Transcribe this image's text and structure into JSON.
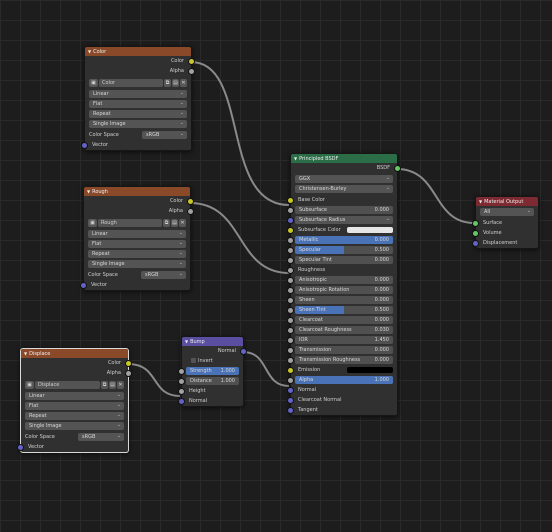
{
  "color_node": {
    "title": "Color",
    "outputs": [
      "Color",
      "Alpha"
    ],
    "image_name": "Color",
    "interpolation": "Linear",
    "projection": "Flat",
    "extension": "Repeat",
    "source": "Single Image",
    "color_space_label": "Color Space",
    "color_space": "sRGB",
    "input": "Vector"
  },
  "rough_node": {
    "title": "Rough",
    "outputs": [
      "Color",
      "Alpha"
    ],
    "image_name": "Rough",
    "interpolation": "Linear",
    "projection": "Flat",
    "extension": "Repeat",
    "source": "Single Image",
    "color_space_label": "Color Space",
    "color_space": "sRGB",
    "input": "Vector"
  },
  "displace_node": {
    "title": "Displace",
    "outputs": [
      "Color",
      "Alpha"
    ],
    "image_name": "Displace",
    "interpolation": "Linear",
    "projection": "Flat",
    "extension": "Repeat",
    "source": "Single Image",
    "color_space_label": "Color Space",
    "color_space": "sRGB",
    "input": "Vector"
  },
  "bump_node": {
    "title": "Bump",
    "output": "Normal",
    "invert_label": "Invert",
    "strength_label": "Strength",
    "strength": "1.000",
    "strength_fraction": 1.0,
    "distance_label": "Distance",
    "distance": "1.000",
    "inputs": [
      "Height",
      "Normal"
    ]
  },
  "bsdf_node": {
    "title": "Principled BSDF",
    "output": "BSDF",
    "distribution": "GGX",
    "subsurface_method": "Christensen-Burley",
    "base_color": "Base Color",
    "subsurface_label": "Subsurface",
    "subsurface": "0.000",
    "subsurface_radius": "Subsurface Radius",
    "subsurface_color": "Subsurface Color",
    "subsurface_color_hex": "#e6e6e6",
    "metallic_label": "Metallic",
    "metallic": "0.000",
    "metallic_fraction": 1.0,
    "specular_label": "Specular",
    "specular": "0.500",
    "specular_fraction": 0.5,
    "specular_tint_label": "Specular Tint",
    "specular_tint": "0.000",
    "roughness": "Roughness",
    "anisotropic_label": "Anisotropic",
    "anisotropic": "0.000",
    "aniso_rot_label": "Anisotropic Rotation",
    "aniso_rot": "0.000",
    "sheen_label": "Sheen",
    "sheen": "0.000",
    "sheen_tint_label": "Sheen Tint",
    "sheen_tint": "0.500",
    "sheen_tint_fraction": 0.5,
    "clearcoat_label": "Clearcoat",
    "clearcoat": "0.000",
    "clearcoat_rough_label": "Clearcoat Roughness",
    "clearcoat_rough": "0.030",
    "ior_label": "IOR",
    "ior": "1.450",
    "transmission_label": "Transmission",
    "transmission": "0.000",
    "transmission_rough_label": "Transmission Roughness",
    "transmission_rough": "0.000",
    "emission": "Emission",
    "emission_hex": "#000000",
    "alpha_label": "Alpha",
    "alpha": "1.000",
    "alpha_fraction": 1.0,
    "normal": "Normal",
    "clearcoat_normal": "Clearcoat Normal",
    "tangent": "Tangent"
  },
  "output_node": {
    "title": "Material Output",
    "target": "All",
    "inputs": [
      "Surface",
      "Volume",
      "Displacement"
    ]
  },
  "colors": {
    "texture_header": "#8a4a2a",
    "shader_header": "#2a6d46",
    "vector_header": "#5a4ea0",
    "output_header": "#7d2a32",
    "slider_fill": "#4a72b6",
    "wire": "#8a8a8a"
  },
  "icons": {
    "collapse": "triangle-down-icon",
    "image": "image-icon",
    "browse": "chevron-down-icon",
    "copy": "duplicate-icon",
    "open": "folder-icon",
    "unlink": "close-icon"
  }
}
